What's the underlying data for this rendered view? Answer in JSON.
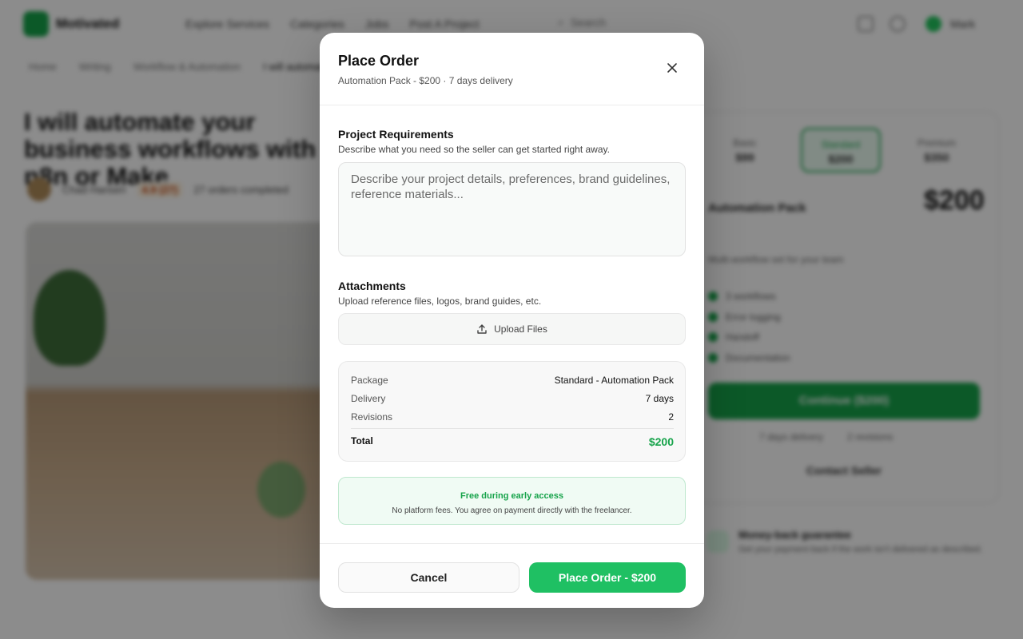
{
  "background": {
    "brand": "Motivated",
    "nav": [
      "Explore Services",
      "Categories",
      "Jobs",
      "Post A Project"
    ],
    "search_label": "Search",
    "user_name": "Mark",
    "breadcrumbs": [
      "Home",
      "Writing",
      "Workflow & Automation",
      "I will automate"
    ],
    "gig_title": "I will automate your business workflows with n8n or Make",
    "seller_name": "Chad Hansen",
    "rating": "4.9 (27)",
    "orders": "27 orders completed",
    "packages": [
      {
        "name": "Basic",
        "price": "$99"
      },
      {
        "name": "Standard",
        "price": "$200"
      },
      {
        "name": "Premium",
        "price": "$350"
      }
    ],
    "package_name": "Automation Pack",
    "package_price": "$200",
    "package_desc": "Multi-workflow set for your team",
    "features": [
      "3 workflows",
      "Error logging",
      "Handoff",
      "Documentation"
    ],
    "continue_label": "Continue ($200)",
    "side_links": [
      "7 days delivery",
      "2 revisions"
    ],
    "contact_label": "Contact Seller",
    "guarantee_title": "Money-back guarantee",
    "guarantee_desc": "Get your payment back if the work isn't delivered as described."
  },
  "modal": {
    "title": "Place Order",
    "subtitle": "Automation Pack - $200 · 7 days delivery",
    "requirements": {
      "title": "Project Requirements",
      "description": "Describe what you need so the seller can get started right away.",
      "placeholder": "Describe your project details, preferences, brand guidelines, reference materials..."
    },
    "attachments": {
      "title": "Attachments",
      "description": "Upload reference files, logos, brand guides, etc.",
      "upload_label": "Upload Files"
    },
    "summary": {
      "rows": [
        {
          "label": "Package",
          "value": "Standard - Automation Pack"
        },
        {
          "label": "Delivery",
          "value": "7 days"
        },
        {
          "label": "Revisions",
          "value": "2"
        }
      ],
      "total_label": "Total",
      "total_value": "$200"
    },
    "notice": {
      "title": "Free during early access",
      "description": "No platform fees. You agree on payment directly with the freelancer."
    },
    "cancel_label": "Cancel",
    "place_order_label": "Place Order - $200"
  },
  "colors": {
    "accent": "#1fc063",
    "accent_text": "#16a34a",
    "overlay": "rgba(0,0,0,0.45)"
  }
}
